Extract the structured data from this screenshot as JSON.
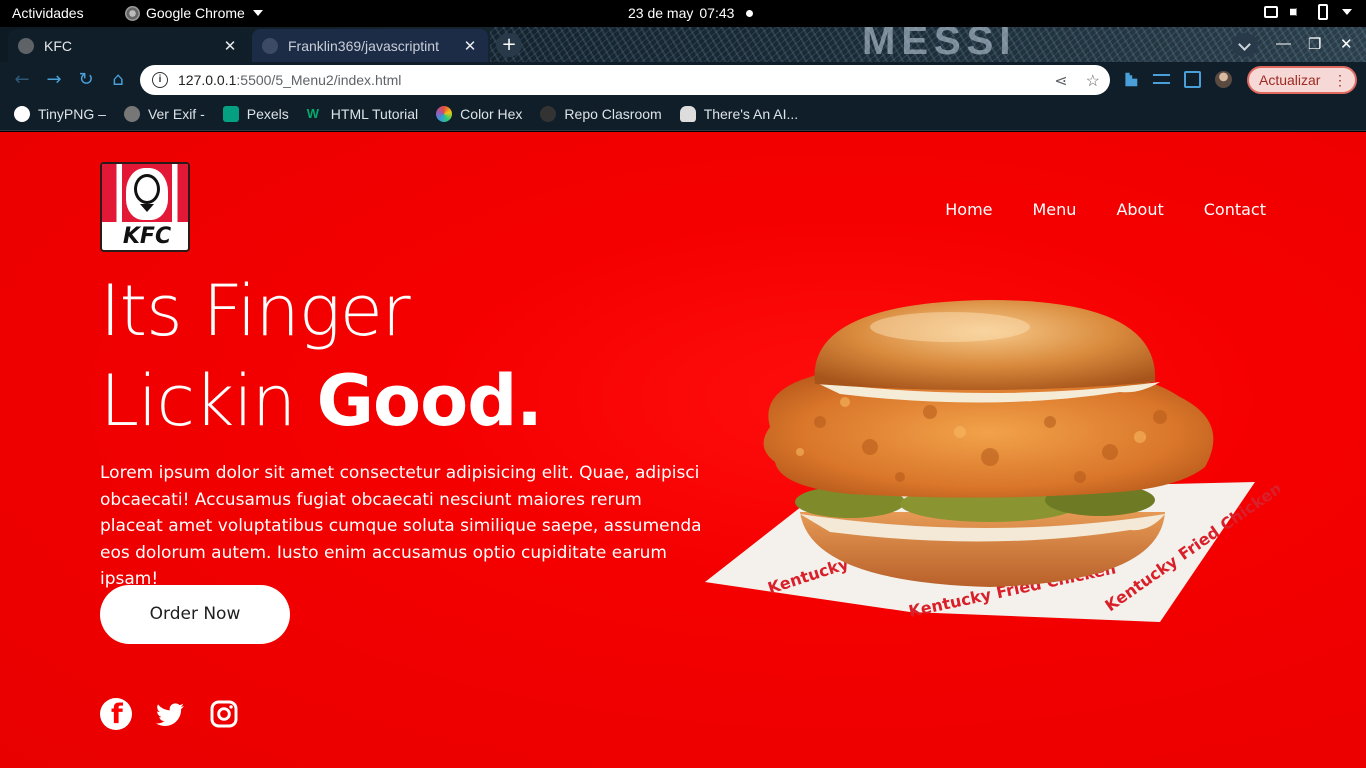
{
  "system_bar": {
    "activities": "Actividades",
    "app_name": "Google Chrome",
    "date": "23 de may",
    "time": "07:43"
  },
  "tabs": [
    {
      "title": "KFC",
      "active": true
    },
    {
      "title": "Franklin369/javascriptint",
      "active": false
    }
  ],
  "wallpaper_text": "MESSI",
  "toolbar": {
    "url_host": "127.0.0.1",
    "url_path": ":5500/5_Menu2/index.html",
    "update_label": "Actualizar"
  },
  "bookmarks": [
    {
      "label": "TinyPNG –",
      "icon": "panda-icon",
      "color": "#ffffff"
    },
    {
      "label": "Ver Exif -",
      "icon": "globe-icon",
      "color": "#888888"
    },
    {
      "label": "Pexels",
      "icon": "pexels-icon",
      "color": "#05a081"
    },
    {
      "label": "HTML Tutorial",
      "icon": "w3schools-icon",
      "color": "#04aa6d"
    },
    {
      "label": "Color Hex",
      "icon": "color-wheel-icon",
      "color": "#e05a2b"
    },
    {
      "label": "Repo Clasroom",
      "icon": "github-icon",
      "color": "#333333"
    },
    {
      "label": "There's An AI...",
      "icon": "hand-icon",
      "color": "#ffffff"
    }
  ],
  "page": {
    "logo_text": "KFC",
    "nav": [
      "Home",
      "Menu",
      "About",
      "Contact"
    ],
    "headline_line1": "Its Finger",
    "headline_line2_light": "Lickin",
    "headline_line2_bold": "Good.",
    "description": "Lorem ipsum dolor sit amet consectetur adipisicing elit. Quae, adipisci obcaecati! Accusamus fugiat obcaecati nesciunt maiores rerum placeat amet voluptatibus cumque soluta similique saepe, assumenda eos dolorum autem. Iusto enim accusamus optio cupiditate earum ipsam!",
    "cta": "Order Now",
    "wrapper_text": "Kentucky Fried Chicken",
    "socials": [
      "facebook-icon",
      "twitter-icon",
      "instagram-icon"
    ],
    "colors": {
      "background": "#f00000",
      "button": "#ffffff",
      "text": "#ffffff"
    }
  }
}
